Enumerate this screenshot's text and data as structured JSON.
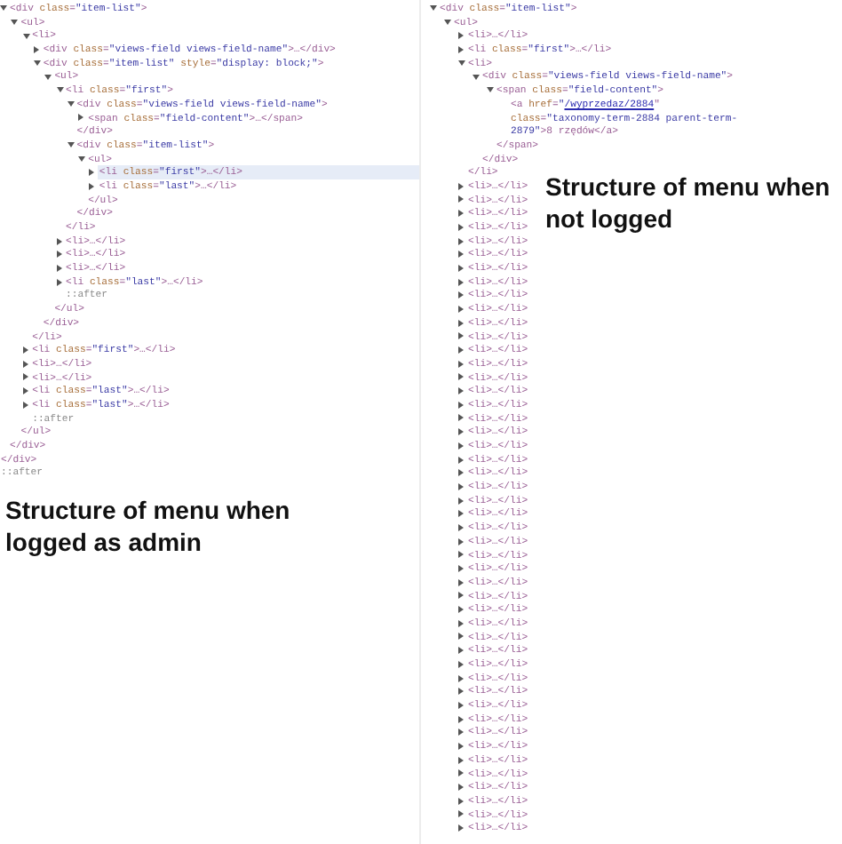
{
  "left_panel": {
    "tree": [
      {
        "kind": "element",
        "text": "<div class=\"item-list\">",
        "expanded": true,
        "selected": false,
        "closing": "</div>",
        "children": [
          {
            "kind": "element",
            "text": "<ul>",
            "expanded": true,
            "selected": false,
            "closing": "</ul>",
            "children": [
              {
                "kind": "element",
                "text": "<li>",
                "expanded": true,
                "selected": false,
                "closing": "</li>",
                "children": [
                  {
                    "kind": "element",
                    "text": "<div class=\"views-field views-field-name\">…</div>",
                    "expanded": false,
                    "selected": false
                  },
                  {
                    "kind": "element",
                    "text": "<div class=\"item-list\" style=\"display: block;\">",
                    "expanded": true,
                    "selected": false,
                    "closing": "</div>",
                    "children": [
                      {
                        "kind": "element",
                        "text": "<ul>",
                        "expanded": true,
                        "selected": false,
                        "closing": "</ul>",
                        "children": [
                          {
                            "kind": "element",
                            "text": "<li class=\"first\">",
                            "expanded": true,
                            "selected": false,
                            "closing": "</li>",
                            "children": [
                              {
                                "kind": "element",
                                "text": "<div class=\"views-field views-field-name\">",
                                "expanded": true,
                                "selected": false,
                                "closing": "</div>",
                                "children": [
                                  {
                                    "kind": "element",
                                    "text": "<span class=\"field-content\">…</span>",
                                    "expanded": false,
                                    "selected": false
                                  }
                                ]
                              },
                              {
                                "kind": "element",
                                "text": "<div class=\"item-list\">",
                                "expanded": true,
                                "selected": false,
                                "closing": "</div>",
                                "children": [
                                  {
                                    "kind": "element",
                                    "text": "<ul>",
                                    "expanded": true,
                                    "selected": false,
                                    "closing": "</ul>",
                                    "children": [
                                      {
                                        "kind": "element",
                                        "text": "<li class=\"first\">…</li>",
                                        "expanded": false,
                                        "selected": true
                                      },
                                      {
                                        "kind": "element",
                                        "text": "<li class=\"last\">…</li>",
                                        "expanded": false,
                                        "selected": false
                                      }
                                    ]
                                  }
                                ]
                              }
                            ]
                          },
                          {
                            "kind": "element",
                            "text": "<li>…</li>",
                            "expanded": false,
                            "selected": false
                          },
                          {
                            "kind": "element",
                            "text": "<li>…</li>",
                            "expanded": false,
                            "selected": false
                          },
                          {
                            "kind": "element",
                            "text": "<li>…</li>",
                            "expanded": false,
                            "selected": false
                          },
                          {
                            "kind": "element",
                            "text": "<li class=\"last\">…</li>",
                            "expanded": false,
                            "selected": false
                          },
                          {
                            "kind": "pseudo",
                            "text": "::after",
                            "selected": false
                          }
                        ]
                      }
                    ]
                  }
                ]
              },
              {
                "kind": "element",
                "text": "<li class=\"first\">…</li>",
                "expanded": false,
                "selected": false
              },
              {
                "kind": "element",
                "text": "<li>…</li>",
                "expanded": false,
                "selected": false
              },
              {
                "kind": "element",
                "text": "<li>…</li>",
                "expanded": false,
                "selected": false
              },
              {
                "kind": "element",
                "text": "<li class=\"last\">…</li>",
                "expanded": false,
                "selected": false
              },
              {
                "kind": "element",
                "text": "<li class=\"last\">…</li>",
                "expanded": false,
                "selected": false
              },
              {
                "kind": "pseudo",
                "text": "::after",
                "selected": false
              }
            ]
          }
        ]
      },
      {
        "kind": "closing",
        "text": "</div>",
        "selected": false
      },
      {
        "kind": "pseudo",
        "text": "::after",
        "selected": false
      }
    ],
    "caption": "Structure of menu when logged as admin"
  },
  "right_panel": {
    "tree": [
      {
        "kind": "element",
        "text": "<div class=\"item-list\">",
        "expanded": true,
        "selected": false,
        "children": [
          {
            "kind": "element",
            "text": "<ul>",
            "expanded": true,
            "selected": false,
            "children": [
              {
                "kind": "element",
                "text": "<li>…</li>",
                "expanded": false,
                "selected": false
              },
              {
                "kind": "element",
                "text": "<li class=\"first\">…</li>",
                "expanded": false,
                "selected": false
              },
              {
                "kind": "element",
                "text": "<li>",
                "expanded": true,
                "selected": false,
                "closing": "</li>",
                "children": [
                  {
                    "kind": "element",
                    "text": "<div class=\"views-field views-field-name\">",
                    "expanded": true,
                    "selected": false,
                    "closing": "</div>",
                    "children": [
                      {
                        "kind": "element",
                        "text": "<span class=\"field-content\">",
                        "expanded": true,
                        "selected": false,
                        "closing": "</span>",
                        "children": [
                          {
                            "kind": "link",
                            "before": "<a href=\"",
                            "href": "/wyprzedaz/2884",
                            "after": "\" class=\"taxonomy-term-2884 parent-term-2879\">8 rzędów</a>",
                            "selected": false
                          }
                        ]
                      }
                    ]
                  }
                ]
              },
              {
                "kind": "element",
                "text": "<li>…</li>",
                "expanded": false,
                "selected": false
              },
              {
                "kind": "element",
                "text": "<li>…</li>",
                "expanded": false,
                "selected": false
              },
              {
                "kind": "element",
                "text": "<li>…</li>",
                "expanded": false,
                "selected": false
              },
              {
                "kind": "element",
                "text": "<li>…</li>",
                "expanded": false,
                "selected": false
              },
              {
                "kind": "element",
                "text": "<li>…</li>",
                "expanded": false,
                "selected": false
              },
              {
                "kind": "element",
                "text": "<li>…</li>",
                "expanded": false,
                "selected": false
              },
              {
                "kind": "element",
                "text": "<li>…</li>",
                "expanded": false,
                "selected": false
              },
              {
                "kind": "element",
                "text": "<li>…</li>",
                "expanded": false,
                "selected": false
              },
              {
                "kind": "element",
                "text": "<li>…</li>",
                "expanded": false,
                "selected": false
              },
              {
                "kind": "element",
                "text": "<li>…</li>",
                "expanded": false,
                "selected": false
              },
              {
                "kind": "element",
                "text": "<li>…</li>",
                "expanded": false,
                "selected": false
              },
              {
                "kind": "element",
                "text": "<li>…</li>",
                "expanded": false,
                "selected": false
              },
              {
                "kind": "element",
                "text": "<li>…</li>",
                "expanded": false,
                "selected": false
              },
              {
                "kind": "element",
                "text": "<li>…</li>",
                "expanded": false,
                "selected": false
              },
              {
                "kind": "element",
                "text": "<li>…</li>",
                "expanded": false,
                "selected": false
              },
              {
                "kind": "element",
                "text": "<li>…</li>",
                "expanded": false,
                "selected": false
              },
              {
                "kind": "element",
                "text": "<li>…</li>",
                "expanded": false,
                "selected": false
              },
              {
                "kind": "element",
                "text": "<li>…</li>",
                "expanded": false,
                "selected": false
              },
              {
                "kind": "element",
                "text": "<li>…</li>",
                "expanded": false,
                "selected": false
              },
              {
                "kind": "element",
                "text": "<li>…</li>",
                "expanded": false,
                "selected": false
              },
              {
                "kind": "element",
                "text": "<li>…</li>",
                "expanded": false,
                "selected": false
              },
              {
                "kind": "element",
                "text": "<li>…</li>",
                "expanded": false,
                "selected": false
              },
              {
                "kind": "element",
                "text": "<li>…</li>",
                "expanded": false,
                "selected": false
              },
              {
                "kind": "element",
                "text": "<li>…</li>",
                "expanded": false,
                "selected": false
              },
              {
                "kind": "element",
                "text": "<li>…</li>",
                "expanded": false,
                "selected": false
              },
              {
                "kind": "element",
                "text": "<li>…</li>",
                "expanded": false,
                "selected": false
              },
              {
                "kind": "element",
                "text": "<li>…</li>",
                "expanded": false,
                "selected": false
              },
              {
                "kind": "element",
                "text": "<li>…</li>",
                "expanded": false,
                "selected": false
              },
              {
                "kind": "element",
                "text": "<li>…</li>",
                "expanded": false,
                "selected": false
              },
              {
                "kind": "element",
                "text": "<li>…</li>",
                "expanded": false,
                "selected": false
              },
              {
                "kind": "element",
                "text": "<li>…</li>",
                "expanded": false,
                "selected": false
              },
              {
                "kind": "element",
                "text": "<li>…</li>",
                "expanded": false,
                "selected": false
              },
              {
                "kind": "element",
                "text": "<li>…</li>",
                "expanded": false,
                "selected": false
              },
              {
                "kind": "element",
                "text": "<li>…</li>",
                "expanded": false,
                "selected": false
              },
              {
                "kind": "element",
                "text": "<li>…</li>",
                "expanded": false,
                "selected": false
              },
              {
                "kind": "element",
                "text": "<li>…</li>",
                "expanded": false,
                "selected": false
              },
              {
                "kind": "element",
                "text": "<li>…</li>",
                "expanded": false,
                "selected": false
              },
              {
                "kind": "element",
                "text": "<li>…</li>",
                "expanded": false,
                "selected": false
              },
              {
                "kind": "element",
                "text": "<li>…</li>",
                "expanded": false,
                "selected": false
              },
              {
                "kind": "element",
                "text": "<li>…</li>",
                "expanded": false,
                "selected": false
              },
              {
                "kind": "element",
                "text": "<li>…</li>",
                "expanded": false,
                "selected": false
              },
              {
                "kind": "element",
                "text": "<li>…</li>",
                "expanded": false,
                "selected": false
              },
              {
                "kind": "element",
                "text": "<li>…</li>",
                "expanded": false,
                "selected": false
              },
              {
                "kind": "element",
                "text": "<li>…</li>",
                "expanded": false,
                "selected": false
              },
              {
                "kind": "element",
                "text": "<li>…</li>",
                "expanded": false,
                "selected": false
              },
              {
                "kind": "element",
                "text": "<li>…</li>",
                "expanded": false,
                "selected": false
              },
              {
                "kind": "element",
                "text": "<li>…</li>",
                "expanded": false,
                "selected": false
              },
              {
                "kind": "element",
                "text": "<li>…</li>",
                "expanded": false,
                "selected": false
              }
            ]
          }
        ]
      }
    ],
    "caption": "Structure of menu when not logged"
  }
}
